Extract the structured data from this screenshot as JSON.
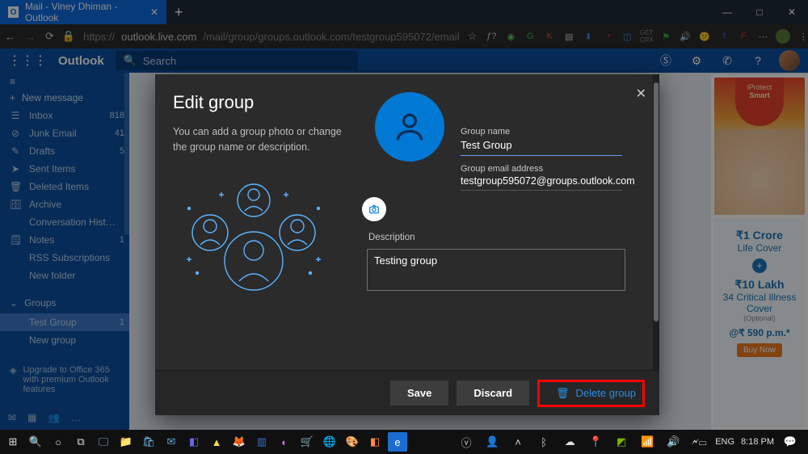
{
  "browser": {
    "tab_title": "Mail - Viney Dhiman - Outlook",
    "url_prefix": "https://",
    "url_host": "outlook.live.com",
    "url_path": "/mail/group/groups.outlook.com/testgroup595072/email"
  },
  "outlook": {
    "brand": "Outlook",
    "search_placeholder": "Search"
  },
  "sidebar": {
    "new_message": "New message",
    "folders": [
      {
        "icon": "☰",
        "label": "Inbox",
        "count": "818"
      },
      {
        "icon": "⊘",
        "label": "Junk Email",
        "count": "41"
      },
      {
        "icon": "✎",
        "label": "Drafts",
        "count": "5"
      },
      {
        "icon": "➤",
        "label": "Sent Items",
        "count": ""
      },
      {
        "icon": "🗑",
        "label": "Deleted Items",
        "count": ""
      },
      {
        "icon": "🗄",
        "label": "Archive",
        "count": ""
      },
      {
        "icon": "",
        "label": "Conversation Hist…",
        "count": ""
      },
      {
        "icon": "🗒",
        "label": "Notes",
        "count": "1"
      },
      {
        "icon": "",
        "label": "RSS Subscriptions",
        "count": ""
      },
      {
        "icon": "",
        "label": "New folder",
        "count": ""
      }
    ],
    "groups_label": "Groups",
    "groups": [
      {
        "label": "Test Group",
        "count": "1",
        "selected": true
      },
      {
        "label": "New group",
        "count": "",
        "selected": false
      }
    ],
    "upgrade": "Upgrade to Office 365 with premium Outlook features"
  },
  "modal": {
    "title": "Edit group",
    "description_text": "You can add a group photo or change the group name or description.",
    "field_group_name_label": "Group name",
    "field_group_name_value": "Test Group",
    "field_email_label": "Group email address",
    "field_email_value": "testgroup595072@groups.outlook.com",
    "field_description_label": "Description",
    "field_description_value": "Testing group",
    "save_label": "Save",
    "discard_label": "Discard",
    "delete_label": "Delete group"
  },
  "ads": {
    "shield_line1": "iProtect",
    "shield_line2": "Smart",
    "line1": "₹1 Crore",
    "line2": "Life Cover",
    "line3": "₹10 Lakh",
    "line4": "34 Critical Illness Cover",
    "line5": "(Optional)",
    "line6": "@₹ 590 p.m.*",
    "btn": "Buy Now"
  },
  "taskbar": {
    "lang": "ENG",
    "time": "8:18 PM"
  }
}
